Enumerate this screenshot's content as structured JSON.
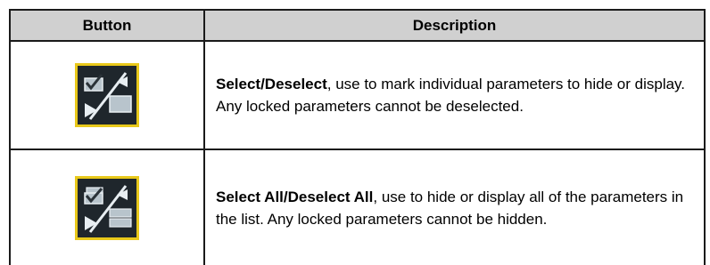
{
  "table": {
    "headers": {
      "button": "Button",
      "description": "Description"
    },
    "rows": [
      {
        "icon": "select-deselect-icon",
        "title": "Select/Deselect",
        "text": ", use to mark individual parameters to hide or display. Any locked parameters cannot be deselected."
      },
      {
        "icon": "select-all-deselect-all-icon",
        "title": "Select All/Deselect All",
        "text": ", use to hide or display all of the parameters in the list. Any locked parameters cannot be hidden."
      }
    ]
  },
  "colors": {
    "header_bg": "#d0d0d0",
    "icon_border": "#e8c81a",
    "icon_bg": "#1f262c"
  }
}
